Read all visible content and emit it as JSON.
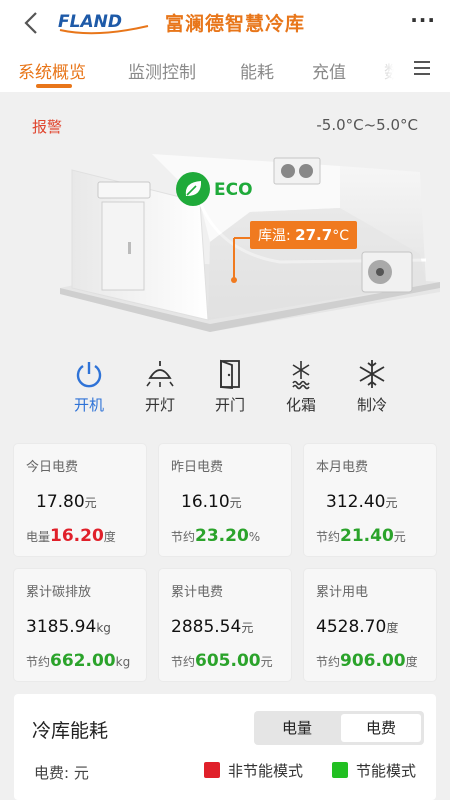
{
  "header": {
    "title": "富澜德智慧冷库",
    "logo_text": "FLAND",
    "more_label": "···"
  },
  "tabs": [
    {
      "label": "系统概览",
      "active": true
    },
    {
      "label": "监测控制",
      "active": false
    },
    {
      "label": "能耗",
      "active": false
    },
    {
      "label": "充值",
      "active": false
    },
    {
      "label": "数",
      "active": false
    }
  ],
  "hero": {
    "alarm_label": "报警",
    "temp_range": "-5.0°C~5.0°C",
    "eco_label": "ECO",
    "temp_tag_label": "库温:",
    "temp_tag_value": "27.7",
    "temp_tag_unit": "°C"
  },
  "controls": [
    {
      "label": "开机",
      "icon": "power-icon",
      "active": true
    },
    {
      "label": "开灯",
      "icon": "lamp-icon",
      "active": false
    },
    {
      "label": "开门",
      "icon": "door-icon",
      "active": false
    },
    {
      "label": "化霜",
      "icon": "defrost-icon",
      "active": false
    },
    {
      "label": "制冷",
      "icon": "snowflake-icon",
      "active": false
    }
  ],
  "cards": [
    {
      "title": "今日电费",
      "value": "17.80",
      "unit": "元",
      "sub_label": "电量",
      "sub_value": "16.20",
      "sub_unit": "度",
      "sub_color": "red"
    },
    {
      "title": "昨日电费",
      "value": "16.10",
      "unit": "元",
      "sub_label": "节约",
      "sub_value": "23.20",
      "sub_unit": "%",
      "sub_color": "green"
    },
    {
      "title": "本月电费",
      "value": "312.40",
      "unit": "元",
      "sub_label": "节约",
      "sub_value": "21.40",
      "sub_unit": "元",
      "sub_color": "green"
    },
    {
      "title": "累计碳排放",
      "value": "3185.94",
      "unit": "kg",
      "sub_label": "节约",
      "sub_value": "662.00",
      "sub_unit": "kg",
      "sub_color": "green"
    },
    {
      "title": "累计电费",
      "value": "2885.54",
      "unit": "元",
      "sub_label": "节约",
      "sub_value": "605.00",
      "sub_unit": "元",
      "sub_color": "green"
    },
    {
      "title": "累计用电",
      "value": "4528.70",
      "unit": "度",
      "sub_label": "节约",
      "sub_value": "906.00",
      "sub_unit": "度",
      "sub_color": "green"
    }
  ],
  "energy": {
    "title": "冷库能耗",
    "toggle": [
      {
        "label": "电量",
        "selected": false
      },
      {
        "label": "电费",
        "selected": true
      }
    ],
    "unit_label": "电费: 元",
    "legend": [
      {
        "label": "非节能模式",
        "color": "#e0202a"
      },
      {
        "label": "节能模式",
        "color": "#22c022"
      }
    ]
  },
  "colors": {
    "accent": "#e8761a",
    "active_control": "#2f73d7",
    "alarm": "#e0452e",
    "eco": "#1faa3a",
    "saving": "#2ba32b",
    "usage": "#e0202a"
  }
}
